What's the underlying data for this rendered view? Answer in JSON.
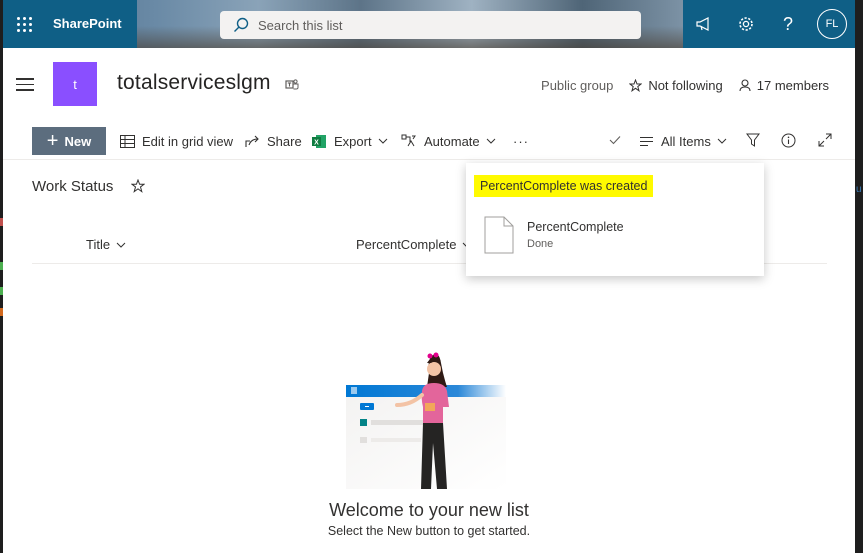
{
  "suite_bar": {
    "app_name": "SharePoint",
    "search_placeholder": "Search this list",
    "avatar_initials": "FL",
    "icons": [
      "waffle-icon",
      "megaphone-icon",
      "gear-icon",
      "help-icon"
    ]
  },
  "site": {
    "logo_letter": "t",
    "name": "totalserviceslgm",
    "group_type": "Public group",
    "follow_label": "Not following",
    "members_label": "17 members"
  },
  "command_bar": {
    "new_label": "New",
    "edit_grid_label": "Edit in grid view",
    "share_label": "Share",
    "export_label": "Export",
    "automate_label": "Automate",
    "more_label": "···",
    "view_label": "All Items"
  },
  "list": {
    "title": "Work Status",
    "columns": [
      "Title",
      "PercentComplete"
    ]
  },
  "notification": {
    "title": "PercentComplete was created",
    "item_name": "PercentComplete",
    "item_status": "Done"
  },
  "empty_state": {
    "heading": "Welcome to your new list",
    "subtext": "Select the New button to get started."
  },
  "colors": {
    "suite_bar": "#0f5f86",
    "site_logo": "#8a4fff",
    "new_button": "#5c6d7e",
    "highlight": "#fffa00"
  }
}
